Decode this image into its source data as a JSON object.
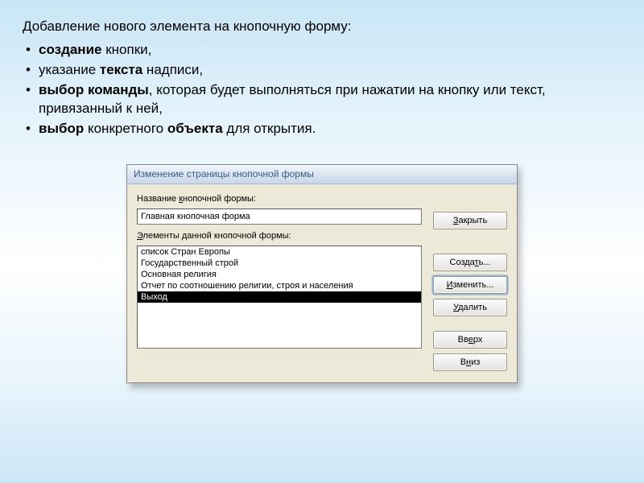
{
  "slide": {
    "heading": "Добавление нового элемента на кнопочную форму:",
    "bullets": [
      {
        "pre": "",
        "b": "создание",
        "post": " кнопки,"
      },
      {
        "pre": "указание ",
        "b": "текста",
        "post": " надписи,"
      },
      {
        "pre": "",
        "b": "выбор команды",
        "post": ", которая будет выполняться при нажатии на кнопку или текст, привязанный к ней,"
      },
      {
        "pre": "",
        "b": "выбор",
        "mid": " конкретного ",
        "b2": "объекта",
        "post": " для открытия."
      }
    ]
  },
  "dialog": {
    "title": "Изменение страницы кнопочной формы",
    "name_label": "Название кнопочной формы:",
    "name_value": "Главная кнопочная форма",
    "elements_label": "Элементы данной кнопочной формы:",
    "items": [
      "список Стран Европы",
      "Государственный строй",
      "Основная религия",
      "Отчет по соотношению религии, строя и населения",
      "Выход"
    ],
    "selected_index": 4,
    "buttons": {
      "close": "Закрыть",
      "create": "Создать...",
      "edit": "Изменить...",
      "delete": "Удалить",
      "up": "Вверх",
      "down": "Вниз"
    }
  }
}
